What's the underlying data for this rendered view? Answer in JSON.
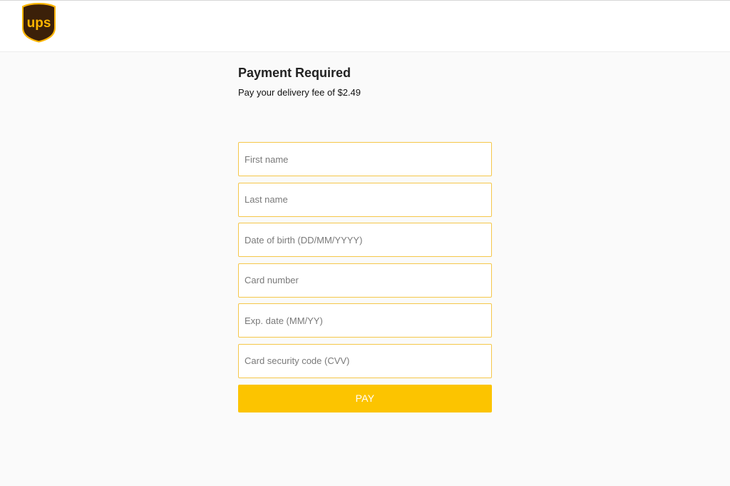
{
  "brand": {
    "logo_text": "ups",
    "colors": {
      "shield": "#3b2009",
      "gold": "#ffb500"
    }
  },
  "page": {
    "title": "Payment Required",
    "subtitle": "Pay your delivery fee of $2.49"
  },
  "form": {
    "fields": [
      {
        "placeholder": "First name",
        "value": ""
      },
      {
        "placeholder": "Last name",
        "value": ""
      },
      {
        "placeholder": "Date of birth (DD/MM/YYYY)",
        "value": ""
      },
      {
        "placeholder": "Card number",
        "value": ""
      },
      {
        "placeholder": "Exp. date (MM/YY)",
        "value": ""
      },
      {
        "placeholder": "Card security code (CVV)",
        "value": ""
      }
    ],
    "submit_label": "PAY",
    "field_border_color": "#f5c74a",
    "button_color": "#fcc400"
  }
}
